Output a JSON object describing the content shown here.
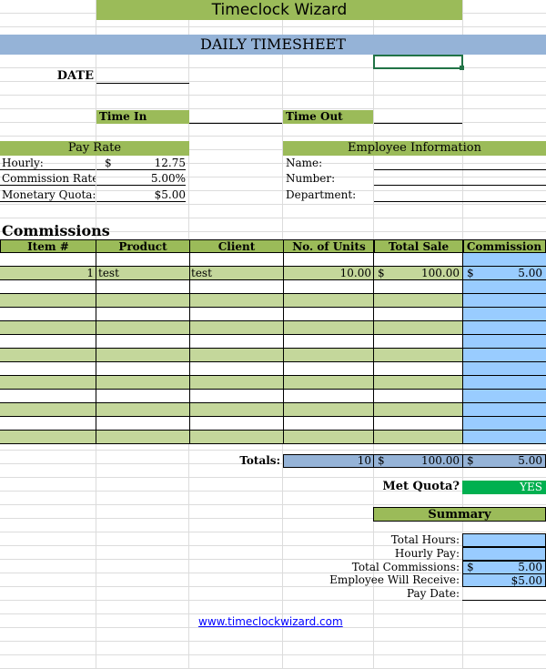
{
  "app_title": "Timeclock Wizard",
  "sheet_title": "DAILY TIMESHEET",
  "date_label": "DATE",
  "time_in_label": "Time In",
  "time_out_label": "Time Out",
  "pay_rate": {
    "header": "Pay Rate",
    "hourly_label": "Hourly:",
    "hourly_currency": "$",
    "hourly_value": "12.75",
    "commission_rate_label": "Commission Rate:",
    "commission_rate_value": "5.00%",
    "quota_label": "Monetary Quota:",
    "quota_value": "$5.00"
  },
  "employee": {
    "header": "Employee Information",
    "name_label": "Name:",
    "number_label": "Number:",
    "department_label": "Department:"
  },
  "commissions": {
    "title": "Commissions",
    "columns": [
      "Item #",
      "Product",
      "Client",
      "No. of Units",
      "Total Sale",
      "Commission"
    ],
    "rows": [
      {
        "item": "1",
        "product": "test",
        "client": "test",
        "units": "10.00",
        "sale_cur": "$",
        "sale": "100.00",
        "comm_cur": "$",
        "comm": "5.00"
      }
    ],
    "totals_label": "Totals:",
    "total_units": "10",
    "total_sale_cur": "$",
    "total_sale": "100.00",
    "total_comm_cur": "$",
    "total_comm": "5.00"
  },
  "quota": {
    "label": "Met Quota?",
    "value": "YES"
  },
  "summary": {
    "header": "Summary",
    "total_hours_label": "Total Hours:",
    "hourly_pay_label": "Hourly Pay:",
    "total_commissions_label": "Total Commissions:",
    "total_commissions_cur": "$",
    "total_commissions_value": "5.00",
    "employee_receive_label": "Employee Will Receive:",
    "employee_receive_value": "$5.00",
    "pay_date_label": "Pay Date:"
  },
  "footer_link": "www.timeclockwizard.com",
  "colors": {
    "green": "#9bbb59",
    "light_green": "#c4d79b",
    "blue": "#95b3d7",
    "light_blue": "#99ccff",
    "quota_green": "#00b050",
    "link": "#0000ff"
  }
}
